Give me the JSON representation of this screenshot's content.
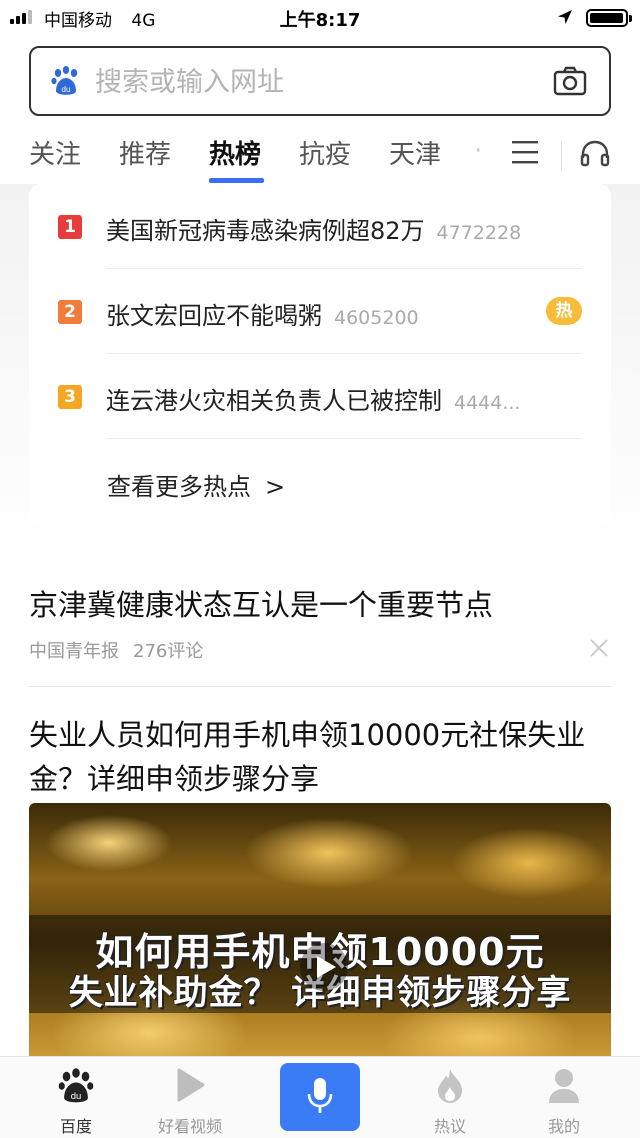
{
  "status_bar": {
    "carrier": "中国移动",
    "network": "4G",
    "time": "上午8:17"
  },
  "search": {
    "placeholder": "搜索或输入网址",
    "logo_icon": "baidu-paw-icon",
    "camera_icon": "camera-icon"
  },
  "tabs": {
    "items": [
      {
        "label": "关注"
      },
      {
        "label": "推荐"
      },
      {
        "label": "热榜"
      },
      {
        "label": "抗疫"
      },
      {
        "label": "天津"
      }
    ],
    "active": "热榜",
    "accent_color": "#3a6ff5"
  },
  "hot_list": {
    "items": [
      {
        "rank": "1",
        "title": "美国新冠病毒感染病例超82万",
        "count": "4772228",
        "rank_color": "#e83b3b",
        "tag": ""
      },
      {
        "rank": "2",
        "title": "张文宏回应不能喝粥",
        "count": "4605200",
        "rank_color": "#f07b3a",
        "tag": "热"
      },
      {
        "rank": "3",
        "title": "连云港火灾相关负责人已被控制",
        "count": "4444...",
        "rank_color": "#f5a623",
        "tag": ""
      }
    ],
    "more_label": "查看更多热点",
    "more_arrow": ">"
  },
  "feed": {
    "news1": {
      "title": "京津冀健康状态互认是一个重要节点",
      "source": "中国青年报",
      "comments": "276评论"
    },
    "news2": {
      "title": "失业人员如何用手机申领10000元社保失业金？详细申领步骤分享",
      "video_line1": "如何用手机申领10000元",
      "video_line2": "失业补助金？ 详细申领步骤分享"
    }
  },
  "bottom_nav": {
    "items": [
      {
        "label": "百度",
        "icon": "baidu-paw-icon"
      },
      {
        "label": "好看视频",
        "icon": "play-icon"
      },
      {
        "label": "",
        "icon": "microphone-icon"
      },
      {
        "label": "热议",
        "icon": "flame-icon"
      },
      {
        "label": "我的",
        "icon": "user-icon"
      }
    ],
    "active": "百度",
    "mic_color": "#3a7bf6"
  }
}
